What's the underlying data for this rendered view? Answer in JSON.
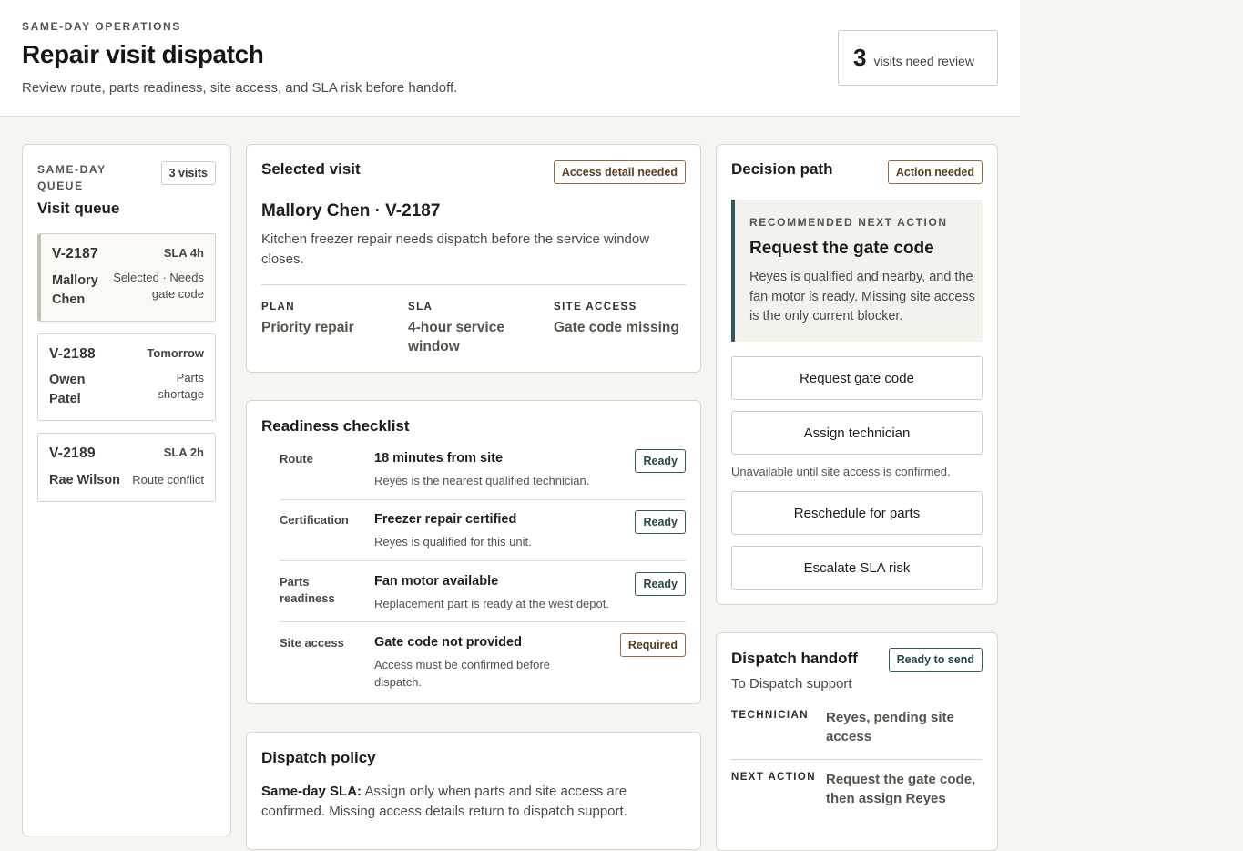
{
  "header": {
    "eyebrow": "SAME-DAY OPERATIONS",
    "title": "Repair visit dispatch",
    "subtitle": "Review route, parts readiness, site access, and SLA risk before handoff.",
    "review_count": "3",
    "review_label": "visits need review"
  },
  "queue": {
    "eyebrow": "SAME-DAY QUEUE",
    "title": "Visit queue",
    "count_badge": "3 visits",
    "items": [
      {
        "id": "V-2187",
        "sla": "SLA 4h",
        "name": "Mallory Chen",
        "status": "Selected · Needs gate code"
      },
      {
        "id": "V-2188",
        "sla": "Tomorrow",
        "name": "Owen Patel",
        "status": "Parts shortage"
      },
      {
        "id": "V-2189",
        "sla": "SLA 2h",
        "name": "Rae Wilson",
        "status": "Route conflict"
      }
    ]
  },
  "selected_visit": {
    "title": "Selected visit",
    "badge": "Access detail needed",
    "customer": "Mallory Chen · V-2187",
    "description": "Kitchen freezer repair needs dispatch before the service window closes.",
    "meta": [
      {
        "label": "PLAN",
        "value": "Priority repair"
      },
      {
        "label": "SLA",
        "value": "4-hour service window"
      },
      {
        "label": "SITE ACCESS",
        "value": "Gate code missing"
      }
    ]
  },
  "checklist": {
    "title": "Readiness checklist",
    "rows": [
      {
        "label": "Route",
        "title": "18 minutes from site",
        "detail": "Reyes is the nearest qualified technician.",
        "status": "Ready"
      },
      {
        "label": "Certification",
        "title": "Freezer repair certified",
        "detail": "Reyes is qualified for this unit.",
        "status": "Ready"
      },
      {
        "label": "Parts readiness",
        "title": "Fan motor available",
        "detail": "Replacement part is ready at the west depot.",
        "status": "Ready"
      },
      {
        "label": "Site access",
        "title": "Gate code not provided",
        "detail": "Access must be confirmed before dispatch.",
        "status": "Required"
      }
    ]
  },
  "policy": {
    "title": "Dispatch policy",
    "lead": "Same-day SLA:",
    "text": " Assign only when parts and site access are confirmed. Missing access details return to dispatch support."
  },
  "decision": {
    "title": "Decision path",
    "badge": "Action needed",
    "rec_eyebrow": "RECOMMENDED NEXT ACTION",
    "rec_title": "Request the gate code",
    "rec_text": "Reyes is qualified and nearby, and the fan motor is ready. Missing site access is the only current blocker.",
    "buttons": {
      "request": "Request gate code",
      "assign": "Assign technician",
      "assign_note": "Unavailable until site access is confirmed.",
      "reschedule": "Reschedule for parts",
      "escalate": "Escalate SLA risk"
    }
  },
  "handoff": {
    "title": "Dispatch handoff",
    "badge": "Ready to send",
    "recipient": "To Dispatch support",
    "rows": [
      {
        "label": "TECHNICIAN",
        "value": "Reyes, pending site access"
      },
      {
        "label": "NEXT ACTION",
        "value": "Request the gate code, then assign Reyes"
      }
    ]
  }
}
